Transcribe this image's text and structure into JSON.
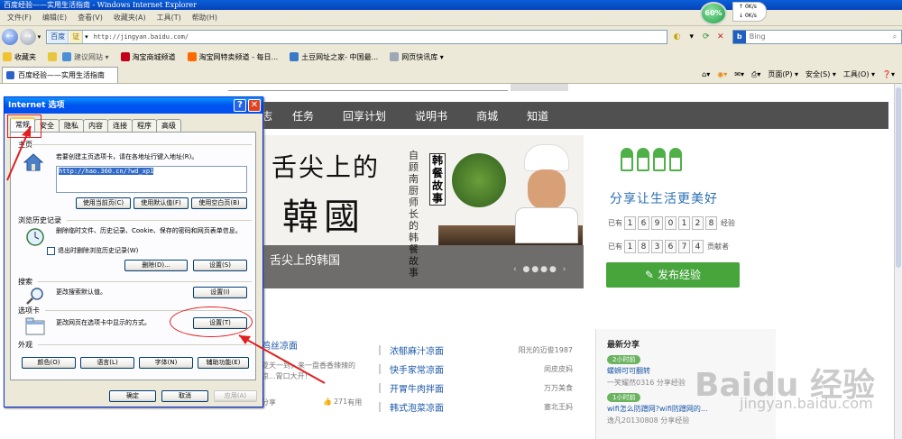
{
  "window": {
    "title": "百度经验——实用生活指南 - Windows Internet Explorer"
  },
  "menubar": [
    "文件(F)",
    "编辑(E)",
    "查看(V)",
    "收藏夹(A)",
    "工具(T)",
    "帮助(H)"
  ],
  "netmeter": {
    "percent": "60%",
    "up": "0K/s",
    "down": "0K/s"
  },
  "address": {
    "badge": "百度",
    "badge2": "证",
    "url": "http://jingyan.baidu.com/",
    "search_placeholder": "Bing"
  },
  "favorites": {
    "label": "收藏夹",
    "items": [
      "建议网站 ▾",
      "淘宝商城频道",
      "淘宝网特卖频道 - 每日...",
      "土豆网址之家- 中国最...",
      "网页快讯库 ▾"
    ]
  },
  "tabs": {
    "active": "百度经验——实用生活指南",
    "commands": [
      "页面(P) ▾",
      "安全(S) ▾",
      "工具(O) ▾",
      "❓▾"
    ]
  },
  "site": {
    "nav": [
      "志",
      "任务",
      "回享计划",
      "说明书",
      "商城",
      "知道"
    ],
    "banner": {
      "line1": "舌尖上的",
      "line2": "韓國",
      "vertical1": "自顾南厨师长的韩餐故事",
      "vertical2": "韩餐故事",
      "caption": "舌尖上的韩国"
    },
    "share": {
      "slogan": "分享让生活更美好",
      "row1_prefix": "已有",
      "row1_digits": [
        "1",
        "6",
        "9",
        "0",
        "1",
        "2",
        "8"
      ],
      "row1_suffix": "经验",
      "row2_prefix": "已有",
      "row2_digits": [
        "1",
        "8",
        "3",
        "6",
        "7",
        "4"
      ],
      "row2_suffix": "贡献者",
      "publish": "发布经验"
    },
    "card1": {
      "title": "鸡丝凉面",
      "desc": "夏天一到，来一盘香香辣辣的凉...胃口大开！",
      "count": "271",
      "count_label": "有用",
      "share_label": "分享"
    },
    "list": [
      {
        "title": "浓郁麻汁凉面",
        "author": "阳光的迈俊1987"
      },
      {
        "title": "快手家常凉面",
        "author": "闵皮皮妈"
      },
      {
        "title": "开胃牛肉拌面",
        "author": "万万美食"
      },
      {
        "title": "韩式泡菜凉面",
        "author": "塞北王妈"
      }
    ],
    "latest": {
      "heading": "最新分享",
      "items": [
        {
          "time": "2小时前",
          "title": "螺蛳可可翻转",
          "meta": "一笑耀然0316  分享经验"
        },
        {
          "time": "1小时前",
          "title": "wifi怎么防蹭网?wifi防蹭网的...",
          "meta": "逸凡20130808  分享经验"
        }
      ]
    },
    "watermark": "Baidu 经验",
    "watermark2": "jingyan.baidu.com"
  },
  "dialog": {
    "title": "Internet 选项",
    "tabs": [
      "常规",
      "安全",
      "隐私",
      "内容",
      "连接",
      "程序",
      "高级"
    ],
    "home": {
      "heading": "主页",
      "hint": "若要创建主页选项卡，请在各地址行键入地址(R)。",
      "url": "http://hao.360.cn/?wd_xp1",
      "buttons": [
        "使用当前页(C)",
        "使用默认值(F)",
        "使用空白页(B)"
      ]
    },
    "history": {
      "heading": "浏览历史记录",
      "text": "删除临时文件、历史记录、Cookie、保存的密码和网页表单信息。",
      "checkbox": "退出时删除浏览历史记录(W)",
      "buttons": [
        "删除(D)...",
        "设置(S)"
      ]
    },
    "search": {
      "heading": "搜索",
      "text": "更改搜索默认值。",
      "button": "设置(I)"
    },
    "tabs_section": {
      "heading": "选项卡",
      "text": "更改网页在选项卡中显示的方式。",
      "button": "设置(T)"
    },
    "appearance": {
      "heading": "外观",
      "buttons": [
        "颜色(O)",
        "语言(L)",
        "字体(N)",
        "辅助功能(E)"
      ]
    },
    "footer": [
      "确定",
      "取消",
      "应用(A)"
    ]
  }
}
